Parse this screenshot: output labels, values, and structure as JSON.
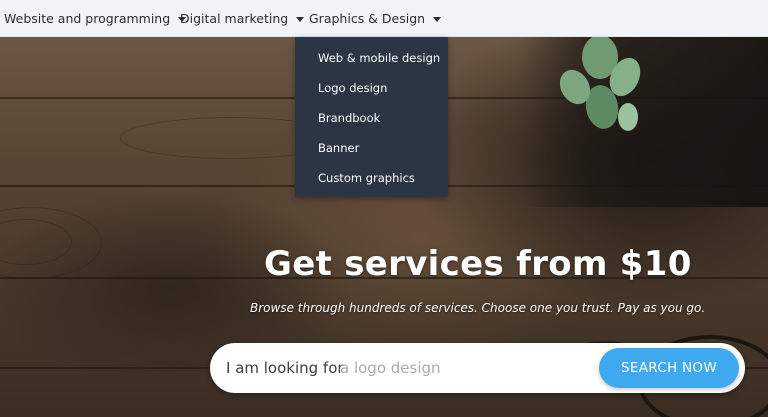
{
  "nav": {
    "items": [
      {
        "label": "Website and programming"
      },
      {
        "label": "Digital marketing"
      },
      {
        "label": "Graphics & Design"
      }
    ]
  },
  "dropdown": {
    "items": [
      {
        "label": "Web & mobile design"
      },
      {
        "label": "Logo design"
      },
      {
        "label": "Brandbook"
      },
      {
        "label": "Banner"
      },
      {
        "label": "Custom graphics"
      }
    ]
  },
  "hero": {
    "headline": "Get services from $10",
    "subline": "Browse through hundreds of services. Choose one you trust. Pay as you go."
  },
  "search": {
    "prefix": "I am looking for",
    "placeholder": "a logo design",
    "button_label": "SEARCH NOW"
  },
  "colors": {
    "nav_bg": "#f0f3f7",
    "dropdown_bg": "#2b3544",
    "search_button": "#3fa9f0"
  },
  "icons": [
    "caret-down-icon",
    "plant-icon",
    "glasses-icon"
  ]
}
